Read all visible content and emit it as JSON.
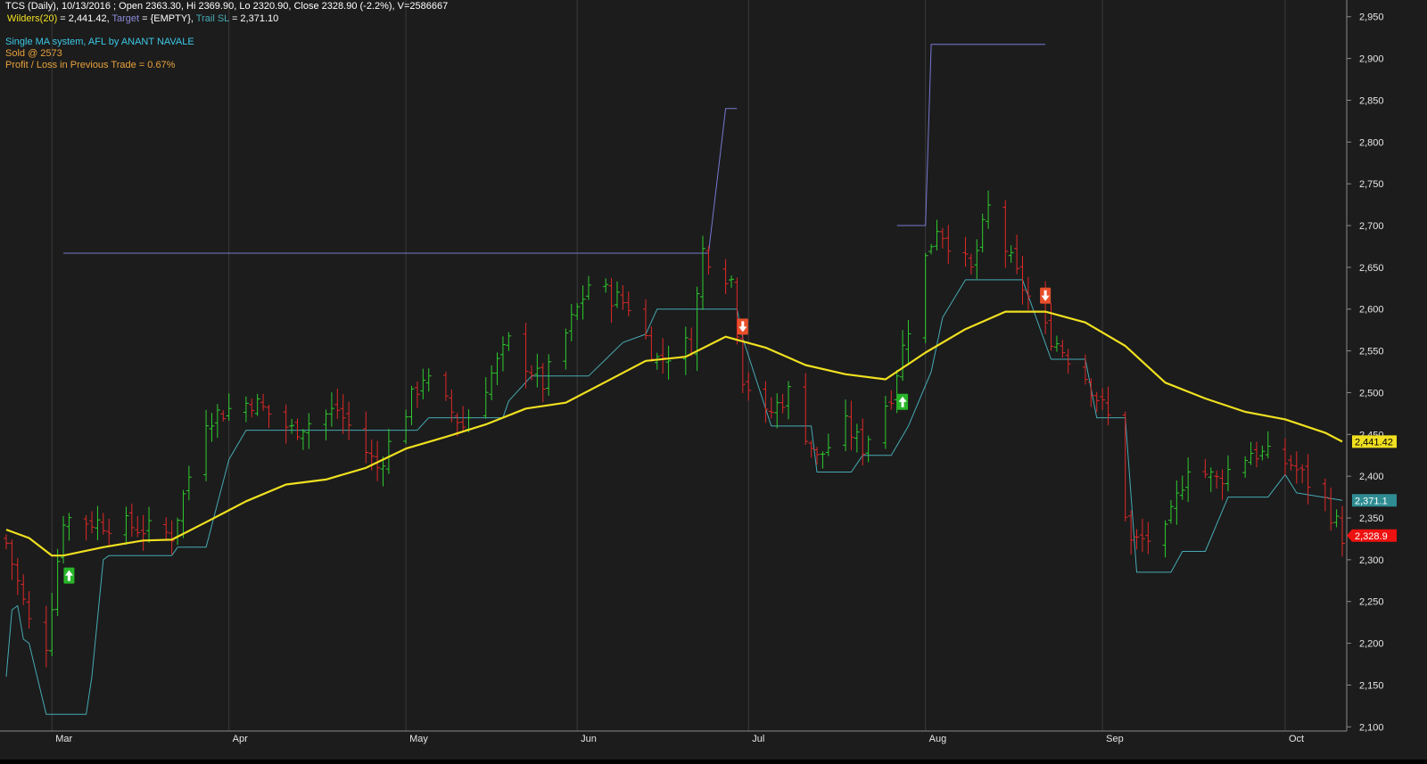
{
  "header": {
    "title_line": "TCS (Daily), 10/13/2016 ; Open 2363.30, Hi 2369.90, Lo 2320.90, Close 2328.90 (-2.2%), V=2586667",
    "wilders_label": "Wilders(20)",
    "wilders_value": " = 2,441.42, ",
    "target_label": "Target",
    "target_value": " = {EMPTY}, ",
    "trail_label": "Trail SL",
    "trail_value": " = 2,371.10",
    "system_name": "Single MA system, AFL by ANANT NAVALE",
    "sold_text": "Sold @ 2573",
    "pl_text": "Profit / Loss in Previous Trade = 0.67%"
  },
  "colors": {
    "background": "#1c1c1c",
    "up_bar": "#2ecc2e",
    "down_bar": "#e02828",
    "wilders": "#f0e020",
    "trail_sl": "#46aab4",
    "target": "#7878d2",
    "grid": "#2e2e2e",
    "axis_text": "#e6e6e6"
  },
  "chart_data": {
    "type": "line",
    "title": "TCS (Daily)",
    "y_axis": {
      "ticks": [
        2100,
        2150,
        2200,
        2250,
        2300,
        2350,
        2400,
        2450,
        2500,
        2550,
        2600,
        2650,
        2700,
        2750,
        2800,
        2850,
        2900,
        2950
      ],
      "tick_labels": [
        "2,100",
        "2,150",
        "2,200",
        "2,250",
        "2,300",
        "2,350",
        "2,400",
        "2,450",
        "2,500",
        "2,550",
        "2,600",
        "2,650",
        "2,700",
        "2,750",
        "2,800",
        "2,850",
        "2,900",
        "2,950"
      ],
      "range": [
        2095,
        2970
      ],
      "position": "right"
    },
    "x_axis": {
      "range": [
        "2016-02-22",
        "2016-10-13"
      ],
      "months": [
        {
          "date": "2016-03-01",
          "label": "Mar"
        },
        {
          "date": "2016-04-01",
          "label": "Apr"
        },
        {
          "date": "2016-05-02",
          "label": "May"
        },
        {
          "date": "2016-06-01",
          "label": "Jun"
        },
        {
          "date": "2016-07-01",
          "label": "Jul"
        },
        {
          "date": "2016-08-01",
          "label": "Aug"
        },
        {
          "date": "2016-09-01",
          "label": "Sep"
        },
        {
          "date": "2016-10-03",
          "label": "Oct"
        }
      ]
    },
    "grid": true,
    "price_anchors": [
      {
        "x": "2016-02-22",
        "y": 2320
      },
      {
        "x": "2016-02-26",
        "y": 2225
      },
      {
        "x": "2016-02-29",
        "y": 2200
      },
      {
        "x": "2016-03-03",
        "y": 2350
      },
      {
        "x": "2016-03-15",
        "y": 2340
      },
      {
        "x": "2016-03-22",
        "y": 2330
      },
      {
        "x": "2016-03-28",
        "y": 2470
      },
      {
        "x": "2016-04-05",
        "y": 2490
      },
      {
        "x": "2016-04-12",
        "y": 2455
      },
      {
        "x": "2016-04-20",
        "y": 2480
      },
      {
        "x": "2016-04-27",
        "y": 2410
      },
      {
        "x": "2016-05-05",
        "y": 2520
      },
      {
        "x": "2016-05-12",
        "y": 2460
      },
      {
        "x": "2016-05-20",
        "y": 2560
      },
      {
        "x": "2016-05-26",
        "y": 2510
      },
      {
        "x": "2016-06-03",
        "y": 2630
      },
      {
        "x": "2016-06-10",
        "y": 2605
      },
      {
        "x": "2016-06-15",
        "y": 2540
      },
      {
        "x": "2016-06-21",
        "y": 2560
      },
      {
        "x": "2016-06-23",
        "y": 2670
      },
      {
        "x": "2016-06-28",
        "y": 2635
      },
      {
        "x": "2016-06-30",
        "y": 2520
      },
      {
        "x": "2016-07-04",
        "y": 2470
      },
      {
        "x": "2016-07-08",
        "y": 2500
      },
      {
        "x": "2016-07-13",
        "y": 2420
      },
      {
        "x": "2016-07-18",
        "y": 2460
      },
      {
        "x": "2016-07-21",
        "y": 2435
      },
      {
        "x": "2016-07-26",
        "y": 2500
      },
      {
        "x": "2016-08-01",
        "y": 2660
      },
      {
        "x": "2016-08-03",
        "y": 2700
      },
      {
        "x": "2016-08-09",
        "y": 2645
      },
      {
        "x": "2016-08-12",
        "y": 2720
      },
      {
        "x": "2016-08-17",
        "y": 2640
      },
      {
        "x": "2016-08-22",
        "y": 2575
      },
      {
        "x": "2016-08-29",
        "y": 2520
      },
      {
        "x": "2016-09-02",
        "y": 2470
      },
      {
        "x": "2016-09-06",
        "y": 2320
      },
      {
        "x": "2016-09-12",
        "y": 2330
      },
      {
        "x": "2016-09-16",
        "y": 2415
      },
      {
        "x": "2016-09-21",
        "y": 2395
      },
      {
        "x": "2016-09-27",
        "y": 2430
      },
      {
        "x": "2016-10-04",
        "y": 2415
      },
      {
        "x": "2016-10-10",
        "y": 2370
      },
      {
        "x": "2016-10-13",
        "y": 2329
      }
    ],
    "series": [
      {
        "name": "Wilders(20)",
        "points": [
          {
            "x": "2016-02-22",
            "y": 2336
          },
          {
            "x": "2016-02-26",
            "y": 2326
          },
          {
            "x": "2016-03-01",
            "y": 2305
          },
          {
            "x": "2016-03-03",
            "y": 2305
          },
          {
            "x": "2016-03-10",
            "y": 2315
          },
          {
            "x": "2016-03-17",
            "y": 2323
          },
          {
            "x": "2016-03-22",
            "y": 2324
          },
          {
            "x": "2016-03-28",
            "y": 2345
          },
          {
            "x": "2016-04-04",
            "y": 2370
          },
          {
            "x": "2016-04-11",
            "y": 2390
          },
          {
            "x": "2016-04-18",
            "y": 2396
          },
          {
            "x": "2016-04-25",
            "y": 2410
          },
          {
            "x": "2016-05-02",
            "y": 2433
          },
          {
            "x": "2016-05-09",
            "y": 2447
          },
          {
            "x": "2016-05-16",
            "y": 2462
          },
          {
            "x": "2016-05-23",
            "y": 2481
          },
          {
            "x": "2016-05-30",
            "y": 2488
          },
          {
            "x": "2016-06-06",
            "y": 2513
          },
          {
            "x": "2016-06-13",
            "y": 2538
          },
          {
            "x": "2016-06-20",
            "y": 2543
          },
          {
            "x": "2016-06-27",
            "y": 2567
          },
          {
            "x": "2016-07-04",
            "y": 2554
          },
          {
            "x": "2016-07-11",
            "y": 2533
          },
          {
            "x": "2016-07-18",
            "y": 2522
          },
          {
            "x": "2016-07-25",
            "y": 2516
          },
          {
            "x": "2016-08-01",
            "y": 2548
          },
          {
            "x": "2016-08-08",
            "y": 2576
          },
          {
            "x": "2016-08-15",
            "y": 2597
          },
          {
            "x": "2016-08-22",
            "y": 2597
          },
          {
            "x": "2016-08-29",
            "y": 2584
          },
          {
            "x": "2016-09-05",
            "y": 2556
          },
          {
            "x": "2016-09-12",
            "y": 2512
          },
          {
            "x": "2016-09-19",
            "y": 2493
          },
          {
            "x": "2016-09-26",
            "y": 2477
          },
          {
            "x": "2016-10-03",
            "y": 2468
          },
          {
            "x": "2016-10-10",
            "y": 2452
          },
          {
            "x": "2016-10-13",
            "y": 2441.42
          }
        ],
        "last_value_label": "2,441.42"
      },
      {
        "name": "Trail SL",
        "points": [
          {
            "x": "2016-02-22",
            "y": 2160
          },
          {
            "x": "2016-02-23",
            "y": 2240
          },
          {
            "x": "2016-02-24",
            "y": 2245
          },
          {
            "x": "2016-02-25",
            "y": 2205
          },
          {
            "x": "2016-02-26",
            "y": 2200
          },
          {
            "x": "2016-02-29",
            "y": 2115
          },
          {
            "x": "2016-03-07",
            "y": 2115
          },
          {
            "x": "2016-03-08",
            "y": 2160
          },
          {
            "x": "2016-03-10",
            "y": 2300
          },
          {
            "x": "2016-03-11",
            "y": 2305
          },
          {
            "x": "2016-03-22",
            "y": 2305
          },
          {
            "x": "2016-03-23",
            "y": 2315
          },
          {
            "x": "2016-03-28",
            "y": 2315
          },
          {
            "x": "2016-04-01",
            "y": 2420
          },
          {
            "x": "2016-04-04",
            "y": 2455
          },
          {
            "x": "2016-05-04",
            "y": 2455
          },
          {
            "x": "2016-05-06",
            "y": 2470
          },
          {
            "x": "2016-05-19",
            "y": 2470
          },
          {
            "x": "2016-05-20",
            "y": 2490
          },
          {
            "x": "2016-05-24",
            "y": 2520
          },
          {
            "x": "2016-05-30",
            "y": 2520
          },
          {
            "x": "2016-06-03",
            "y": 2520
          },
          {
            "x": "2016-06-06",
            "y": 2540
          },
          {
            "x": "2016-06-09",
            "y": 2560
          },
          {
            "x": "2016-06-13",
            "y": 2570
          },
          {
            "x": "2016-06-15",
            "y": 2600
          },
          {
            "x": "2016-06-29",
            "y": 2600
          },
          {
            "x": "2016-06-30",
            "y": 2565
          },
          {
            "x": "2016-07-05",
            "y": 2460
          },
          {
            "x": "2016-07-12",
            "y": 2460
          },
          {
            "x": "2016-07-13",
            "y": 2405
          },
          {
            "x": "2016-07-19",
            "y": 2405
          },
          {
            "x": "2016-07-21",
            "y": 2425
          },
          {
            "x": "2016-07-26",
            "y": 2425
          },
          {
            "x": "2016-07-29",
            "y": 2460
          },
          {
            "x": "2016-08-02",
            "y": 2525
          },
          {
            "x": "2016-08-04",
            "y": 2590
          },
          {
            "x": "2016-08-08",
            "y": 2635
          },
          {
            "x": "2016-08-18",
            "y": 2635
          },
          {
            "x": "2016-08-23",
            "y": 2540
          },
          {
            "x": "2016-08-29",
            "y": 2540
          },
          {
            "x": "2016-08-31",
            "y": 2470
          },
          {
            "x": "2016-09-05",
            "y": 2470
          },
          {
            "x": "2016-09-07",
            "y": 2285
          },
          {
            "x": "2016-09-13",
            "y": 2285
          },
          {
            "x": "2016-09-15",
            "y": 2310
          },
          {
            "x": "2016-09-19",
            "y": 2310
          },
          {
            "x": "2016-09-23",
            "y": 2375
          },
          {
            "x": "2016-09-30",
            "y": 2375
          },
          {
            "x": "2016-10-03",
            "y": 2402
          },
          {
            "x": "2016-10-05",
            "y": 2380
          },
          {
            "x": "2016-10-13",
            "y": 2371.1
          }
        ],
        "last_value_label": "2,371.1"
      },
      {
        "name": "Target",
        "segments": [
          [
            {
              "x": "2016-03-03",
              "y": 2667
            },
            {
              "x": "2016-06-24",
              "y": 2667
            },
            {
              "x": "2016-06-27",
              "y": 2840
            },
            {
              "x": "2016-06-29",
              "y": 2840
            }
          ],
          [
            {
              "x": "2016-07-27",
              "y": 2700
            },
            {
              "x": "2016-08-01",
              "y": 2700
            },
            {
              "x": "2016-08-02",
              "y": 2917
            },
            {
              "x": "2016-08-22",
              "y": 2917
            }
          ]
        ]
      }
    ],
    "signals": [
      {
        "type": "buy",
        "x": "2016-03-04",
        "y": 2280
      },
      {
        "type": "sell",
        "x": "2016-06-30",
        "y": 2578
      },
      {
        "type": "buy",
        "x": "2016-07-28",
        "y": 2488
      },
      {
        "type": "sell",
        "x": "2016-08-22",
        "y": 2615
      }
    ],
    "last_close": 2328.9,
    "last_close_label": "2,328.9"
  }
}
